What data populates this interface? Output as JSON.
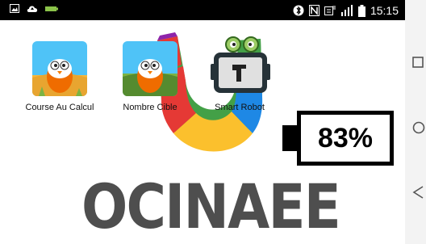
{
  "status_bar": {
    "left_icons": [
      "gallery-icon",
      "cloud-upload-icon",
      "battery-charge-notify-icon"
    ],
    "right_icons": [
      "bluetooth-icon",
      "nfc-icon",
      "data-saver-icon",
      "signal-icon",
      "battery-status-icon"
    ],
    "time": "15:15"
  },
  "apps": [
    {
      "label": "Course Au Calcul",
      "icon": "owl-desert-icon"
    },
    {
      "label": "Nombre Cible",
      "icon": "owl-field-icon"
    },
    {
      "label": "Smart Robot",
      "icon": "robot-phone-icon"
    }
  ],
  "battery_overlay": {
    "percent": "83%"
  },
  "brand": {
    "wordmark": "OCINAEE",
    "accent_colors": [
      "#e53935",
      "#43a047",
      "#1e88e5",
      "#fbc02d",
      "#8e24aa"
    ]
  },
  "nav_bar": {
    "buttons": [
      "recent-apps-icon",
      "home-icon",
      "back-icon"
    ]
  }
}
